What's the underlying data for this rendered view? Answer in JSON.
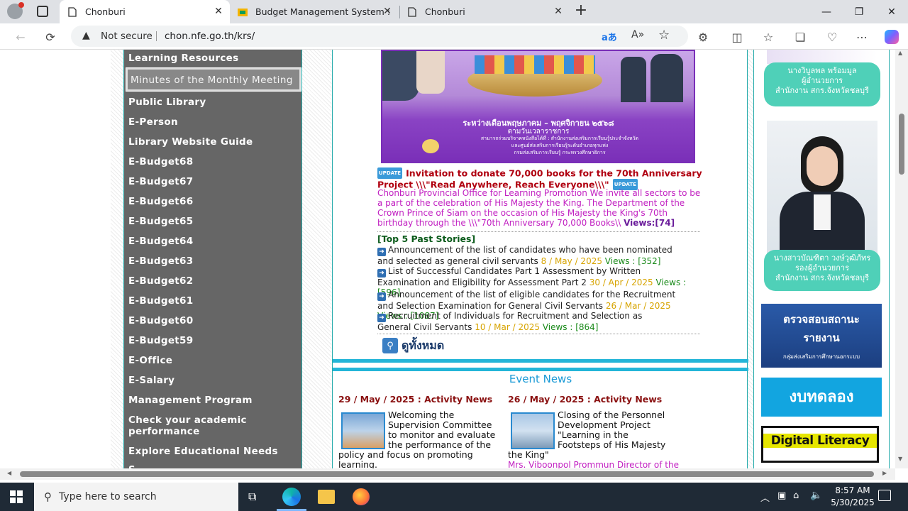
{
  "browser": {
    "tabs": [
      {
        "title": "Chonburi",
        "active": true
      },
      {
        "title": "Budget Management System : Of",
        "active": false
      },
      {
        "title": "Chonburi",
        "active": false
      }
    ],
    "security_label": "Not secure",
    "url": "chon.nfe.go.th/krs/"
  },
  "sidebar": {
    "items": [
      "Learning Resources",
      "Minutes of the Monthly Meeting",
      "Public Library",
      "E-Person",
      "Library Website Guide",
      "E-Budget68",
      "E-Budget67",
      "E-Budget66",
      "E-Budget65",
      "E-Budget64",
      "E-Budget63",
      "E-Budget62",
      "E-Budget61",
      "E-Budget60",
      "E-Budget59",
      "E-Office",
      "E-Salary",
      "Management Program",
      "Check your academic performance",
      "Explore Educational Needs"
    ],
    "selected_index": 1
  },
  "banner": {
    "line1": "ระหว่างเดือนพฤษภาคม – พฤศจิกายน ๒๕๖๘",
    "line2": "ตามวันเวลาราชการ",
    "line3": "สามารถร่วมบริจาคหนังสือได้ที่ : สำนักงานส่งเสริมการเรียนรู้ประจำจังหวัด",
    "line4": "และศูนย์ส่งเสริมการเรียนรู้ระดับอำเภอทุกแห่ง",
    "line5": "กรมส่งเสริมการเรียนรู้ กระทรวงศึกษาธิการ"
  },
  "featured": {
    "badge": "UPDATE",
    "title": "Invitation to donate 70,000 books for the 70th Anniversary Project \\\\\\\"Read Anywhere, Reach Everyone\\\\\\\"",
    "body": "Chonburi Provincial Office for Learning Promotion We invite all sectors to be a part of the celebration of His Majesty the King. The Department of the Crown Prince of Siam on the occasion of His Majesty the King's 70th birthday through the \\\\\\\"70th Anniversary 70,000 Books\\\\",
    "views_label": "Views:[74]"
  },
  "top_stories": {
    "heading": "[Top 5 Past Stories]",
    "items": [
      {
        "text": "Announcement of the list of candidates who have been nominated and selected as general civil servants",
        "date": "8 / May / 2025",
        "views": "Views : [352]"
      },
      {
        "text": "List of Successful Candidates Part 1 Assessment by Written Examination and Eligibility for Assessment Part 2",
        "date": "30 / Apr / 2025",
        "views": "Views : [596]"
      },
      {
        "text": "Announcement of the list of eligible candidates for the Recruitment and Selection Examination for General Civil Servants",
        "date": "26 / Mar / 2025",
        "views": "Views : [1087]"
      },
      {
        "text": "Recruitment of Individuals for Recruitment and Selection as General Civil Servants",
        "date": "10 / Mar / 2025",
        "views": "Views : [864]"
      }
    ],
    "view_all": "ดูทั้งหมด"
  },
  "events": {
    "heading": "Event News",
    "items": [
      {
        "date": "29 / May / 2025 : Activity News",
        "title": "Welcoming the Supervision Committee to monitor and evaluate the performance of the policy and focus on promoting learning."
      },
      {
        "date": "26 / May / 2025 : Activity News",
        "title": "Closing of the Personnel Development Project \"Learning in the Footsteps of His Majesty the King\"",
        "sub": "Mrs. Viboonpol Prommun Director of the"
      }
    ]
  },
  "right": {
    "person1": [
      "นางวิบูลพล พร้อมมูล",
      "ผู้อำนวยการ",
      "สำนักงาน สกร.จังหวัดชลบุรี"
    ],
    "person2": [
      "นางสาวบัณฑิตา วงษ์วุฒิภัทร",
      "รองผู้อำนวยการ",
      "สำนักงาน สกร.จังหวัดชลบุรี"
    ],
    "banner1_line1": "ตรวจสอบสถานะ",
    "banner1_line2": "รายงาน",
    "banner1_line3": "กลุ่มส่งเสริมการศึกษานอกระบบ",
    "banner2": "งบทดลอง",
    "banner3": "Digital Literacy"
  },
  "taskbar": {
    "search_placeholder": "Type here to search",
    "time": "8:57 AM",
    "date": "5/30/2025"
  }
}
